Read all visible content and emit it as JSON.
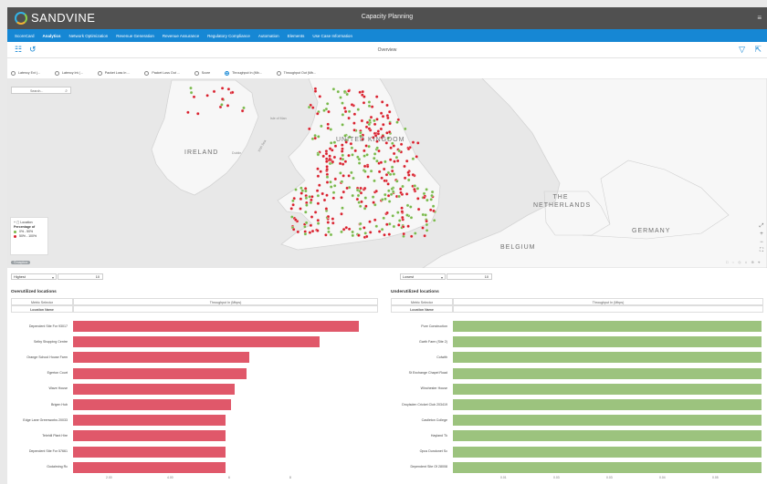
{
  "app": {
    "brand": "SANDVINE",
    "title": "Capacity Planning",
    "menu_glyph": "≡"
  },
  "nav": [
    "ScoreCard",
    "Analytics",
    "Network Optimization",
    "Revenue Generation",
    "Revenue Assurance",
    "Regulatory Compliance",
    "Automation",
    "Elements",
    "Use Case Information"
  ],
  "nav_active_index": 1,
  "toolbar": {
    "title": "Overview",
    "left_icons": [
      "grid-icon",
      "history-icon"
    ],
    "right_icons": [
      "filter-icon",
      "export-icon"
    ]
  },
  "metric_radios": [
    {
      "label": "Latency Ext (...",
      "selected": false
    },
    {
      "label": "Latency Int (...",
      "selected": false
    },
    {
      "label": "Packet Loss In ...",
      "selected": false
    },
    {
      "label": "Packet Loss Out ...",
      "selected": false
    },
    {
      "label": "Score",
      "selected": false
    },
    {
      "label": "Throughput In (Mb...",
      "selected": true
    },
    {
      "label": "Throughput Out (Mb...",
      "selected": false
    }
  ],
  "map": {
    "search_placeholder": "Search...",
    "labels": {
      "uk": "UNITED KINGDOM",
      "ireland": "IRELAND",
      "netherlands": "THE NETHERLANDS",
      "germany": "GERMANY",
      "belgium": "BELGIUM",
      "dublin": "Dublin",
      "isle_of_man": "Isle of Man",
      "irish_sea": "Irish Sea"
    },
    "legend": {
      "title": "Location",
      "subtitle": "Percentage of",
      "items": [
        {
          "label": "0% - 50%",
          "color": "#78b84a"
        },
        {
          "label": "50% - 100%",
          "color": "#d81f2c"
        }
      ]
    },
    "controls": [
      "⤢",
      "+",
      "−",
      "⛶"
    ],
    "bottom_tools": "□ ◌ ◇ ⌂ ⊕ ⌖",
    "logo": "©mapbox"
  },
  "left_panel": {
    "sort": "Highest",
    "count": "10",
    "title": "Overutilized locations",
    "metric_selector_label": "Metric Selector",
    "metric_value": "Throughput In (Mbps)",
    "location_header": "Location Name",
    "bar_color": "#e0586a",
    "ticks": [
      "2.00",
      "4.00",
      "6",
      "8"
    ],
    "rows": [
      {
        "name": "Dependent Site For 93017",
        "value": 9.4
      },
      {
        "name": "Selby Shopping Centre",
        "value": 8.1
      },
      {
        "name": "Orange School House Farm",
        "value": 5.8
      },
      {
        "name": "Egerton Court",
        "value": 5.7
      },
      {
        "name": "Wave House",
        "value": 5.3
      },
      {
        "name": "Brigen Hub",
        "value": 5.2
      },
      {
        "name": "Edge Lane Greenworks 20033",
        "value": 5.0
      },
      {
        "name": "Telehill Plant Hire",
        "value": 5.0
      },
      {
        "name": "Dependent Site For 57661",
        "value": 5.0
      },
      {
        "name": "Godalming Rc",
        "value": 5.0
      }
    ]
  },
  "right_panel": {
    "sort": "Lowest",
    "count": "10",
    "title": "Underutilized locations",
    "metric_selector_label": "Metric Selector",
    "metric_value": "Throughput In (Mbps)",
    "location_header": "Location Name",
    "bar_color": "#9cc37e",
    "ticks": [
      "0.01",
      "0.03",
      "0.03",
      "0.04",
      "0.05"
    ],
    "rows": [
      {
        "name": "Pure Construction",
        "value": 0.06
      },
      {
        "name": "Garth Farm (Site 2)",
        "value": 0.06
      },
      {
        "name": "Colwith",
        "value": 0.06
      },
      {
        "name": "St Exchange Chapel Road",
        "value": 0.06
      },
      {
        "name": "Winchester House",
        "value": 0.06
      },
      {
        "name": "Droylsden Cricket Club 203419",
        "value": 0.06
      },
      {
        "name": "Castleton College",
        "value": 0.06
      },
      {
        "name": "Hayland Tk",
        "value": 0.06
      },
      {
        "name": "Opus Dundonet Sc",
        "value": 0.06
      },
      {
        "name": "Dependent Site Of 28008",
        "value": 0.06
      }
    ]
  }
}
